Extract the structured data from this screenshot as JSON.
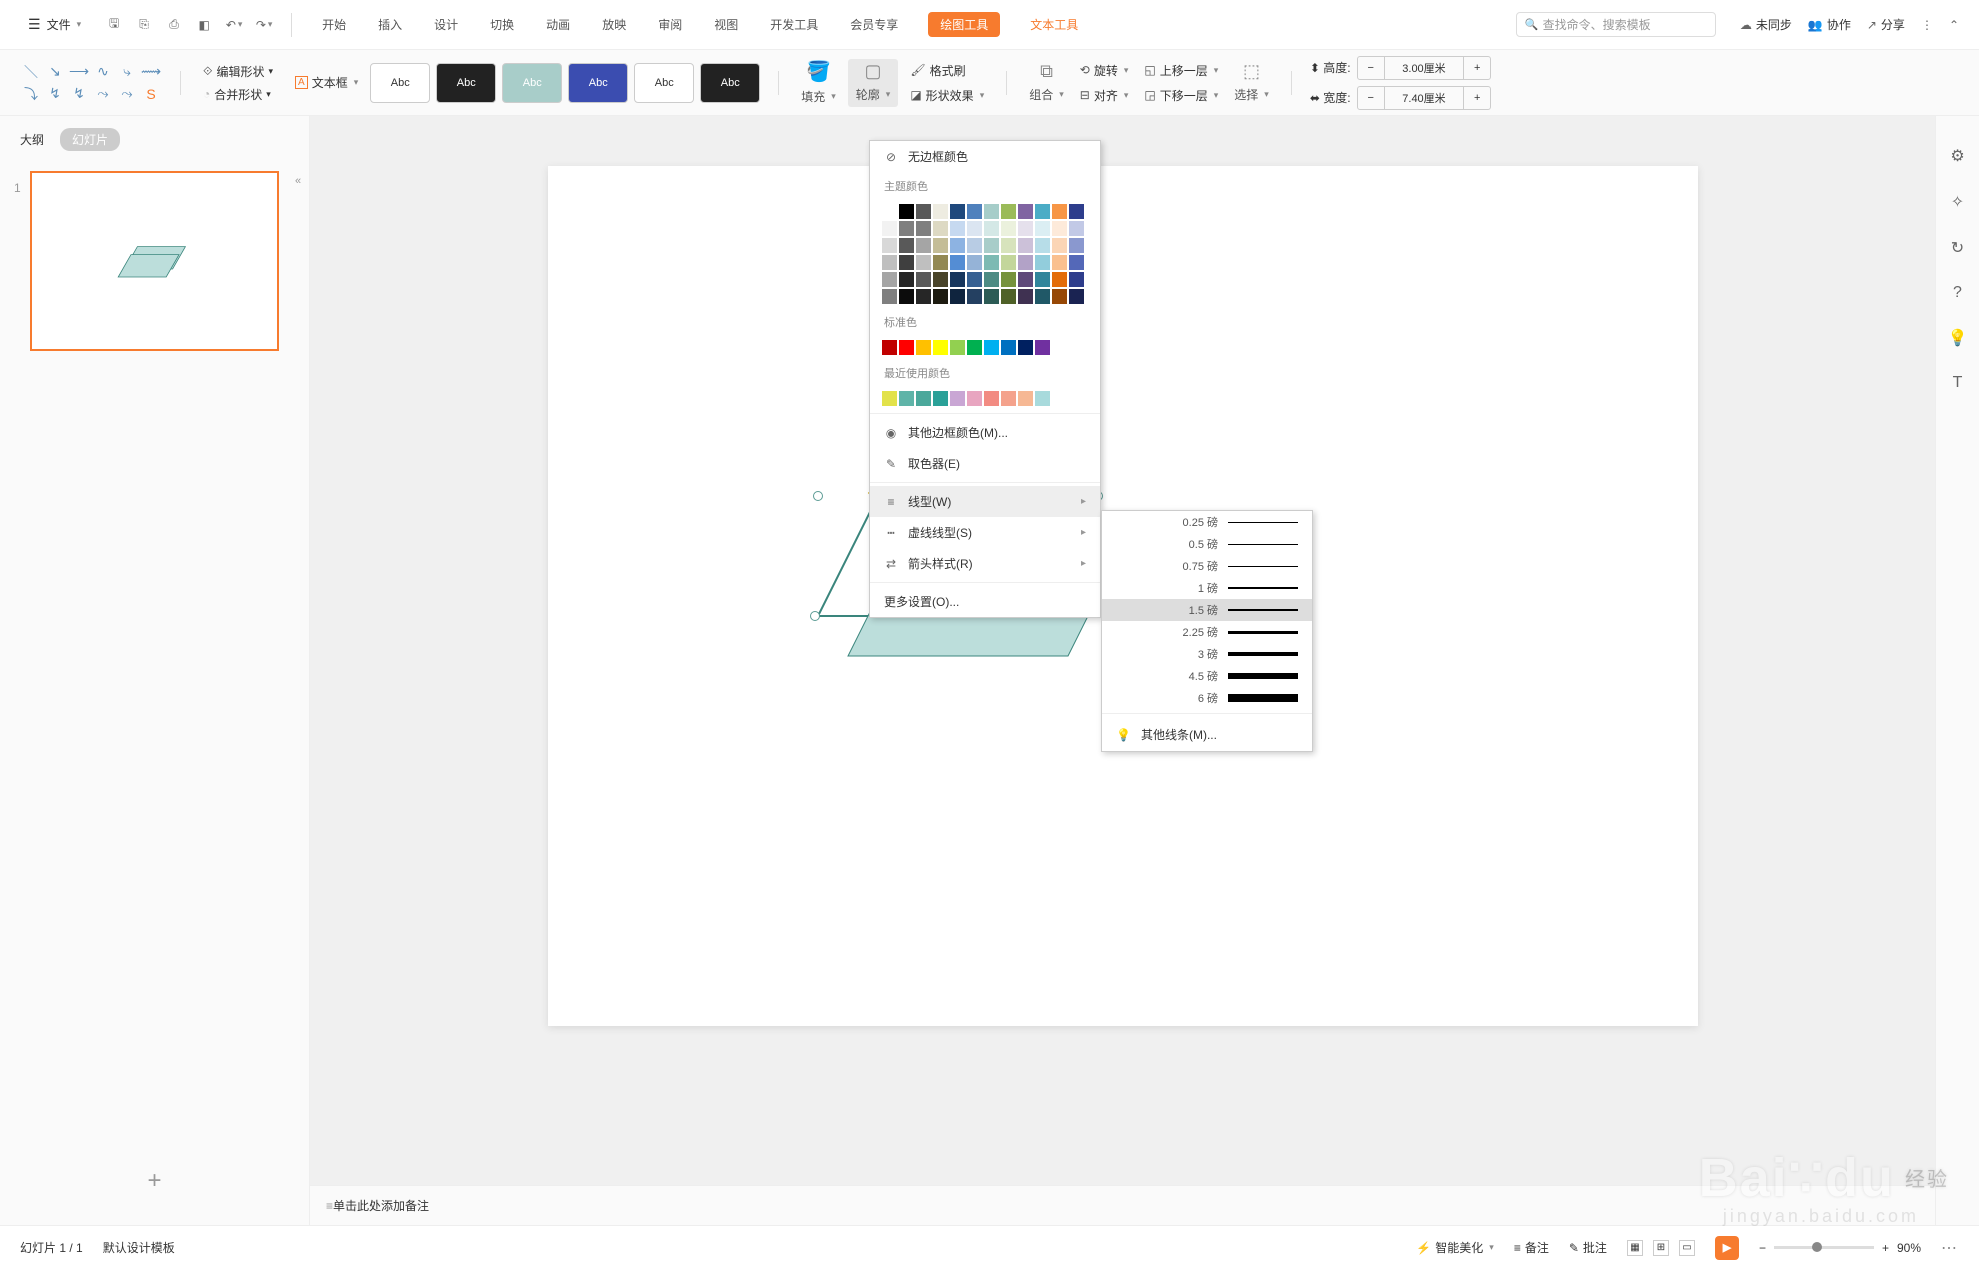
{
  "file_menu": "文件",
  "tabs": {
    "start": "开始",
    "insert": "插入",
    "design": "设计",
    "transition": "切换",
    "animation": "动画",
    "slideshow": "放映",
    "review": "审阅",
    "view": "视图",
    "devtools": "开发工具",
    "member": "会员专享",
    "drawing": "绘图工具",
    "text": "文本工具"
  },
  "search_placeholder": "查找命令、搜索模板",
  "top_right": {
    "unsync": "未同步",
    "collab": "协作",
    "share": "分享"
  },
  "ribbon": {
    "edit_shape": "编辑形状",
    "merge_shape": "合并形状",
    "text_box": "文本框",
    "style_label": "Abc",
    "fill": "填充",
    "outline": "轮廓",
    "effect": "形状效果",
    "format_painter": "格式刷",
    "group": "组合",
    "rotate": "旋转",
    "bring_fwd": "上移一层",
    "align": "对齐",
    "send_back": "下移一层",
    "select": "选择",
    "height": "高度:",
    "width": "宽度:",
    "height_val": "3.00厘米",
    "width_val": "7.40厘米"
  },
  "panel": {
    "outline": "大纲",
    "slides": "幻灯片",
    "collapse": "«"
  },
  "outline_menu": {
    "no_border": "无边框颜色",
    "theme_colors": "主题颜色",
    "standard_colors": "标准色",
    "recent_colors": "最近使用颜色",
    "more_border": "其他边框颜色(M)...",
    "eyedropper": "取色器(E)",
    "weight": "线型(W)",
    "dashes": "虚线线型(S)",
    "arrows": "箭头样式(R)",
    "more_settings": "更多设置(O)..."
  },
  "theme_grid": [
    [
      "#ffffff",
      "#000000",
      "#595959",
      "#eeece1",
      "#1f497d",
      "#4f81bd",
      "#a6cdc9",
      "#9bbb59",
      "#8064a2",
      "#4bacc6",
      "#f79646",
      "#2e3d8c"
    ],
    [
      "#f2f2f2",
      "#7f7f7f",
      "#7f7f7f",
      "#ddd9c3",
      "#c6d9f0",
      "#dbe5f1",
      "#d4e8e6",
      "#ebf1dd",
      "#e5e0ec",
      "#dbeef3",
      "#fdeada",
      "#c2c9e6"
    ],
    [
      "#d8d8d8",
      "#595959",
      "#a5a5a5",
      "#c4bd97",
      "#8db3e2",
      "#b8cce4",
      "#a8cdc9",
      "#d7e3bc",
      "#ccc1d9",
      "#b7dde8",
      "#fbd5b5",
      "#8a98cf"
    ],
    [
      "#bfbfbf",
      "#3f3f3f",
      "#bfbfbf",
      "#938953",
      "#548dd4",
      "#95b3d7",
      "#7dbab3",
      "#c3d69b",
      "#b2a2c7",
      "#92cddc",
      "#fac08f",
      "#5468b8"
    ],
    [
      "#a5a5a5",
      "#262626",
      "#595959",
      "#494429",
      "#17365d",
      "#366092",
      "#4d8b83",
      "#76923c",
      "#5f497a",
      "#31859b",
      "#e36c09",
      "#2e3d8c"
    ],
    [
      "#7f7f7f",
      "#0c0c0c",
      "#262626",
      "#1d1b10",
      "#0f243e",
      "#244061",
      "#2c5b55",
      "#4f6128",
      "#3f3151",
      "#205867",
      "#974806",
      "#1a2352"
    ]
  ],
  "standard_row": [
    "#c00000",
    "#ff0000",
    "#ffc000",
    "#ffff00",
    "#92d050",
    "#00b050",
    "#00b0f0",
    "#0070c0",
    "#002060",
    "#7030a0"
  ],
  "recent_row": [
    "#e2e24a",
    "#5fb4a8",
    "#4ba89b",
    "#2aa198",
    "#c9a6d4",
    "#e8a5c0",
    "#f28b82",
    "#f4a28c",
    "#f6b894",
    "#a8dadc"
  ],
  "weights": [
    {
      "label": "0.25 磅",
      "h": 1
    },
    {
      "label": "0.5 磅",
      "h": 1
    },
    {
      "label": "0.75 磅",
      "h": 1
    },
    {
      "label": "1 磅",
      "h": 2
    },
    {
      "label": "1.5 磅",
      "h": 2
    },
    {
      "label": "2.25 磅",
      "h": 3
    },
    {
      "label": "3 磅",
      "h": 4
    },
    {
      "label": "4.5 磅",
      "h": 6
    },
    {
      "label": "6 磅",
      "h": 8
    }
  ],
  "weight_more": "其他线条(M)...",
  "notes": "单击此处添加备注",
  "status": {
    "slide": "幻灯片 1 / 1",
    "template": "默认设计模板",
    "beautify": "智能美化",
    "notes": "备注",
    "comment": "批注",
    "zoom": "90%"
  }
}
